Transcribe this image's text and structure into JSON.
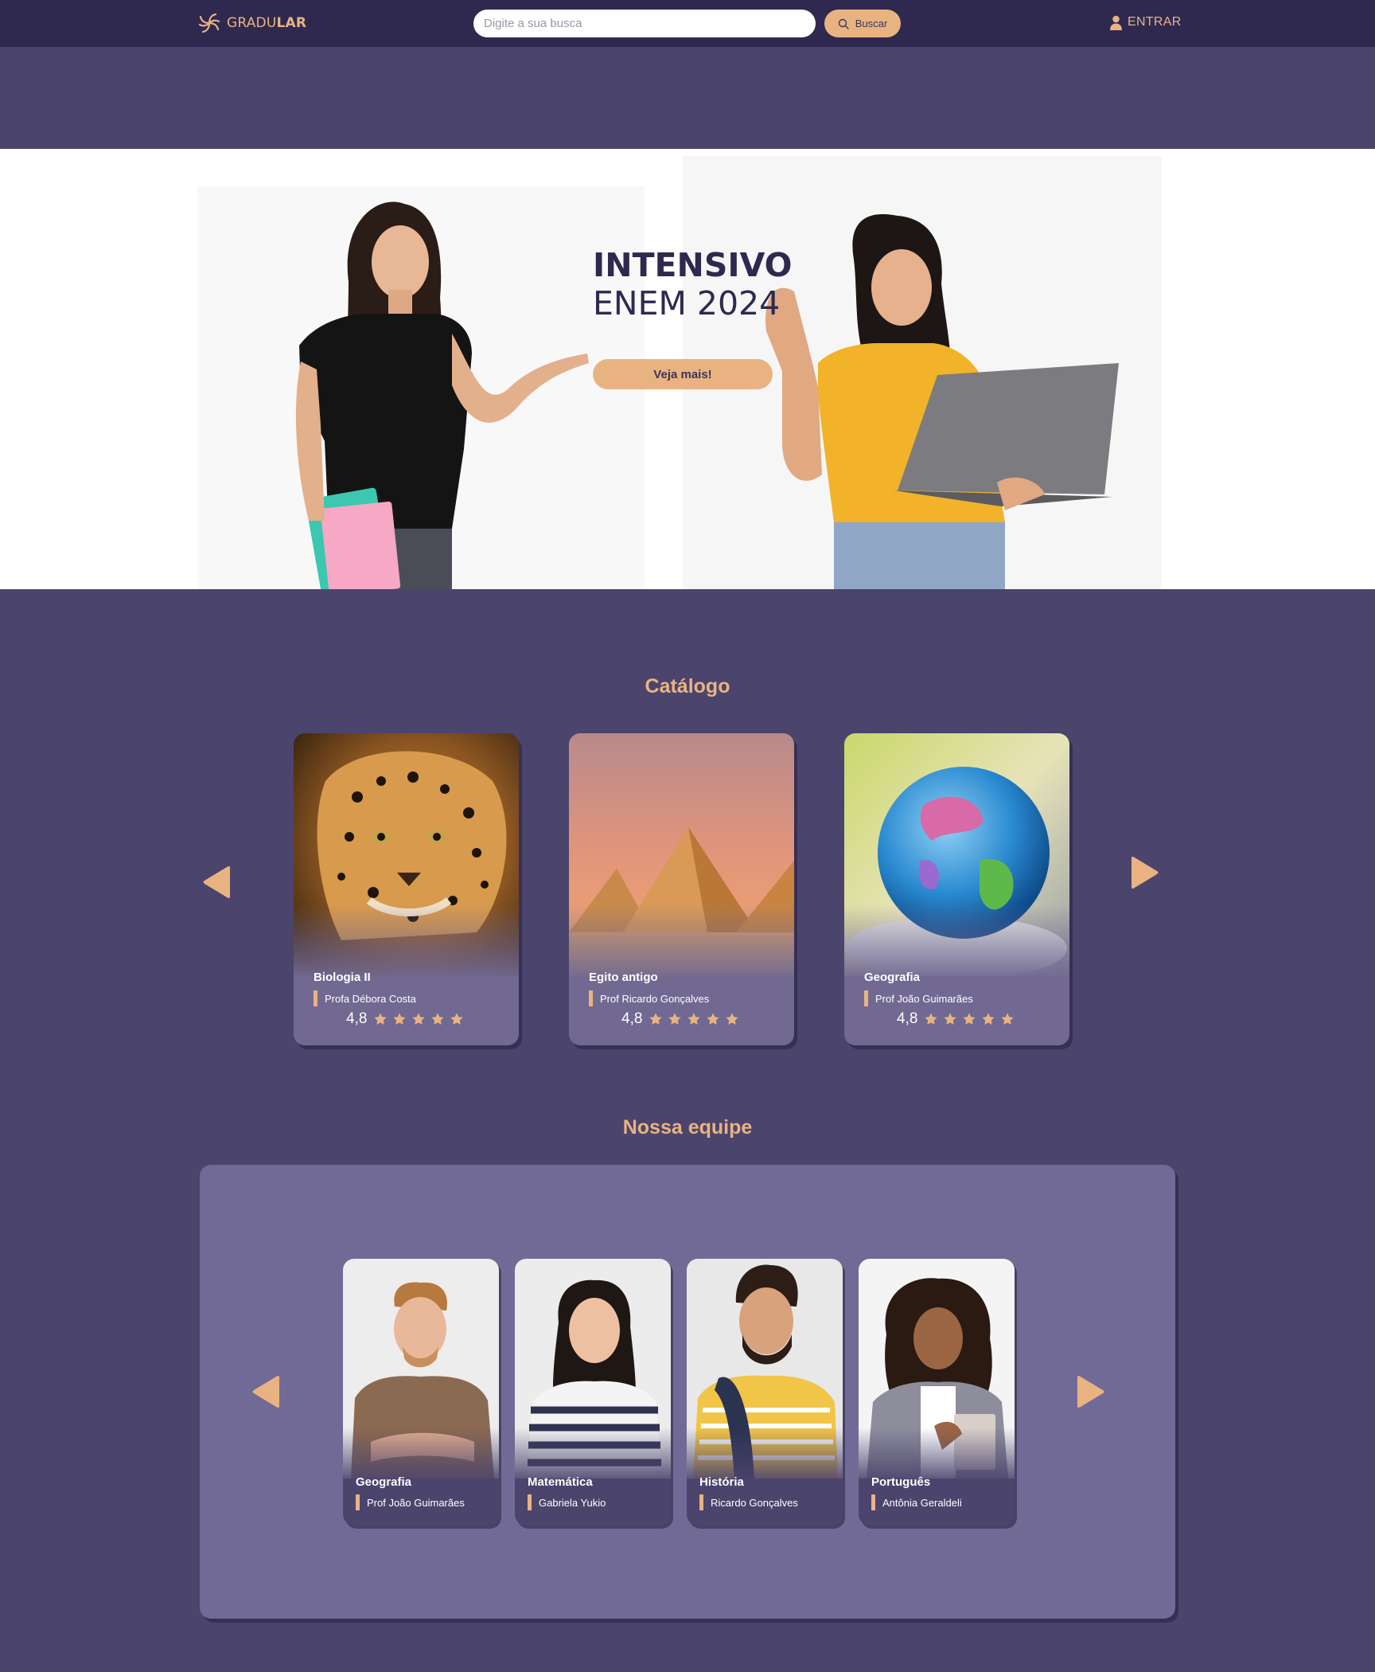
{
  "colors": {
    "page_bg": "#4b446d",
    "header_bg": "#2f2950",
    "accent": "#e9b381",
    "card_bg": "#716991",
    "panel_bg": "#726a96",
    "title_dark": "#2f2950"
  },
  "header": {
    "logo_icon": "spiral-logo-icon",
    "logo_text_regular": "GRADU",
    "logo_text_bold": "LAR",
    "search_placeholder": "Digite a sua busca",
    "search_value": "",
    "search_button_label": "Buscar",
    "search_icon": "search-icon",
    "login_icon": "user-icon",
    "login_label": "ENTRAR"
  },
  "hero": {
    "title_line1": "INTENSIVO",
    "title_line2": "ENEM 2024",
    "button_label": "Veja mais!"
  },
  "catalog": {
    "title": "Catálogo",
    "prev_icon": "arrow-left-icon",
    "next_icon": "arrow-right-icon",
    "courses": [
      {
        "title": "Biologia II",
        "teacher": "Profa Débora Costa",
        "rating": "4,8",
        "stars": 5,
        "image": "jaguar-photo"
      },
      {
        "title": "Egito antigo",
        "teacher": "Prof Ricardo Gonçalves",
        "rating": "4,8",
        "stars": 5,
        "image": "pyramids-photo"
      },
      {
        "title": "Geografia",
        "teacher": "Prof João Guimarães",
        "rating": "4,8",
        "stars": 5,
        "image": "globe-photo"
      }
    ]
  },
  "team": {
    "title": "Nossa equipe",
    "prev_icon": "arrow-left-icon",
    "next_icon": "arrow-right-icon",
    "members": [
      {
        "subject": "Geografia",
        "name": "Prof João Guimarães"
      },
      {
        "subject": "Matemática",
        "name": "Gabriela Yukio"
      },
      {
        "subject": "História",
        "name": "Ricardo Gonçalves"
      },
      {
        "subject": "Português",
        "name": "Antônia Geraldeli"
      }
    ]
  }
}
